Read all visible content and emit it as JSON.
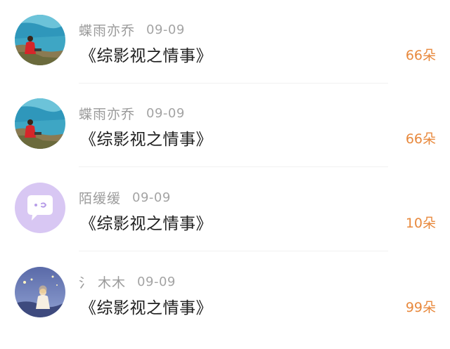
{
  "comments": [
    {
      "username": "蝶雨亦乔",
      "date": "09-09",
      "title": "《综影视之情事》",
      "count": "66朵",
      "avatar": "seaside-photo-avatar"
    },
    {
      "username": "蝶雨亦乔",
      "date": "09-09",
      "title": "《综影视之情事》",
      "count": "66朵",
      "avatar": "seaside-photo-avatar"
    },
    {
      "username": "陌缓缓",
      "date": "09-09",
      "title": "《综影视之情事》",
      "count": "10朵",
      "avatar": "default-chat-bubble-avatar"
    },
    {
      "username": "氵 木木",
      "date": "09-09",
      "title": "《综影视之情事》",
      "count": "99朵",
      "avatar": "night-sky-girl-avatar"
    }
  ],
  "colors": {
    "accent": "#e8893d",
    "username": "#9a9a9a",
    "title": "#1e1e1e",
    "default_avatar_bg": "#d8c7f3"
  }
}
